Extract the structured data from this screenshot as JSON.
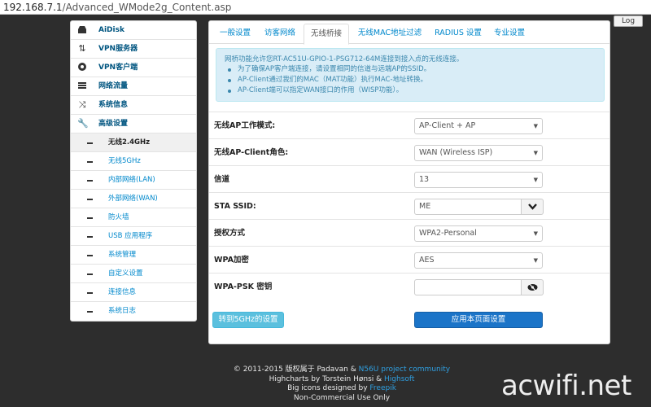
{
  "browser": {
    "url_host": "192.168.7.1",
    "url_path": "/Advanced_WMode2g_Content.asp",
    "log_button": "Log"
  },
  "sidebar": {
    "items": [
      {
        "icon": "hdd-icon",
        "label": "AiDisk"
      },
      {
        "icon": "retweet-icon",
        "label": "VPN服务器"
      },
      {
        "icon": "globe-icon",
        "label": "VPN客户端"
      },
      {
        "icon": "list-icon",
        "label": "网络流量"
      },
      {
        "icon": "random-icon",
        "label": "系统信息"
      },
      {
        "icon": "wrench-icon",
        "label": "高级设置"
      }
    ],
    "subitems": [
      {
        "label": "无线2.4GHz",
        "active": true
      },
      {
        "label": "无线5GHz"
      },
      {
        "label": "内部网络(LAN)"
      },
      {
        "label": "外部网络(WAN)"
      },
      {
        "label": "防火墙"
      },
      {
        "label": "USB 应用程序"
      },
      {
        "label": "系统管理"
      },
      {
        "label": "自定义设置"
      },
      {
        "label": "连接信息"
      },
      {
        "label": "系统日志"
      }
    ]
  },
  "tabs": [
    {
      "label": "一般设置"
    },
    {
      "label": "访客网络"
    },
    {
      "label": "无线桥接",
      "active": true
    },
    {
      "label": "无线MAC地址过滤"
    },
    {
      "label": "RADIUS 设置"
    },
    {
      "label": "专业设置"
    }
  ],
  "info": {
    "intro": "网桥功能允许您RT-AC51U-GPIO-1-PSG712-64M连接到接入点的无线连接。",
    "bullets": [
      "为了确保AP客户端连接，请设置相同的信道与远端AP的SSID。",
      "AP-Client通过我们的MAC（MAT功能）执行MAC-地址转换。",
      "AP-Client端可以指定WAN接口的作用（WISP功能）。"
    ]
  },
  "form": {
    "ap_mode": {
      "label": "无线AP工作模式:",
      "value": "AP-Client + AP"
    },
    "client_role": {
      "label": "无线AP-Client角色:",
      "value": "WAN (Wireless ISP)"
    },
    "channel": {
      "label": "信道",
      "value": "13"
    },
    "ssid": {
      "label": "STA SSID:",
      "value": "ME"
    },
    "auth": {
      "label": "授权方式",
      "value": "WPA2-Personal"
    },
    "encryption": {
      "label": "WPA加密",
      "value": "AES"
    },
    "psk": {
      "label": "WPA-PSK 密钥",
      "value": ""
    }
  },
  "buttons": {
    "to_5g": "转到5GHz的设置",
    "apply": "应用本页面设置"
  },
  "footer": {
    "line1_prefix": "© 2011-2015 版权属于 Padavan &",
    "line1_link": "N56U project community",
    "line2_prefix": "Highcharts by Torstein Hønsi &",
    "line2_link": "Highsoft",
    "line3_prefix": "Big icons designed by",
    "line3_link": "Freepik",
    "line4": "Non-Commercial Use Only"
  },
  "watermark": "acwifi.net"
}
